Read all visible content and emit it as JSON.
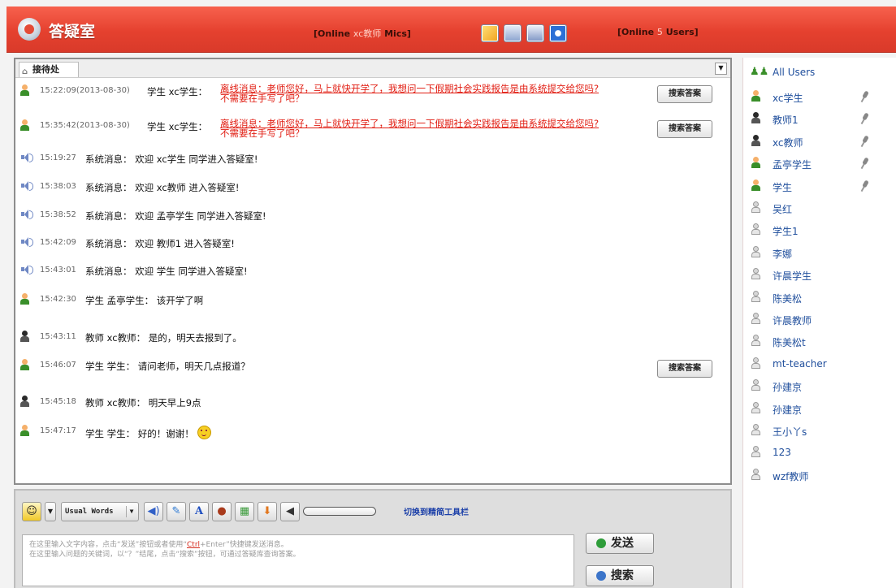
{
  "header": {
    "title": "答疑室",
    "online_mics": {
      "prefix": "[Online",
      "name": "xc教师",
      "suffix": "Mics]"
    },
    "online_users": {
      "prefix": "[Online",
      "count": "5",
      "suffix": "Users]"
    },
    "icons": [
      "folder-icon",
      "document-icon",
      "calculator-icon",
      "chat-icon"
    ]
  },
  "chat": {
    "tab_label": "接待处",
    "messages": [
      {
        "kind": "question",
        "ts": "15:22:09(2013-08-30)",
        "role": "学生",
        "name": "xc学生：",
        "line1": "离线消息：老师您好，马上就快开学了，我想问一下假期社会实践报告是由系统提交给您吗?",
        "line2": "不需要在手写了吧？",
        "button": "搜索答案"
      },
      {
        "kind": "question",
        "ts": "15:35:42(2013-08-30)",
        "role": "学生",
        "name": "xc学生：",
        "line1": "离线消息：老师您好，马上就快开学了，我想问一下假期社会实践报告是由系统提交给您吗?",
        "line2": "不需要在手写了吧？",
        "button": "搜索答案"
      },
      {
        "kind": "system",
        "ts": "15:19:27",
        "text": "系统消息： 欢迎 xc学生 同学进入答疑室!"
      },
      {
        "kind": "system",
        "ts": "15:38:03",
        "text": "系统消息： 欢迎 xc教师 进入答疑室!"
      },
      {
        "kind": "system",
        "ts": "15:38:52",
        "text": "系统消息： 欢迎 孟亭学生 同学进入答疑室!"
      },
      {
        "kind": "system",
        "ts": "15:42:09",
        "text": "系统消息： 欢迎 教师1 进入答疑室!"
      },
      {
        "kind": "system",
        "ts": "15:43:01",
        "text": "系统消息： 欢迎 学生 同学进入答疑室!"
      },
      {
        "kind": "student",
        "ts": "15:42:30",
        "text": "学生 孟亭学生： 该开学了啊"
      },
      {
        "kind": "teacher",
        "ts": "15:43:11",
        "text": "教师 xc教师： 是的，明天去报到了。"
      },
      {
        "kind": "student",
        "ts": "15:46:07",
        "text": "学生 学生： 请问老师，明天几点报道？",
        "button": "搜索答案"
      },
      {
        "kind": "teacher",
        "ts": "15:45:18",
        "text": "教师 xc教师： 明天早上9点"
      },
      {
        "kind": "student",
        "ts": "15:47:17",
        "text": "学生 学生： 好的！谢谢！"
      }
    ]
  },
  "toolbar": {
    "usual_words": "Usual Words",
    "switch_link": "切换到精简工具栏",
    "tool_icons": [
      "emoji-icon",
      "dropdown-icon",
      "sound-icon",
      "edit-icon",
      "font-icon",
      "user-icon",
      "image-icon",
      "download-icon",
      "volume-icon"
    ]
  },
  "input": {
    "hint_line1_a": "在这里输入文字内容，点击“发送”按钮或者使用“",
    "hint_ctrl": "Ctrl",
    "hint_line1_b": "+Enter”快捷键发送消息。",
    "hint_line2": "在这里输入问题的关键词，以“？”结尾，点击“搜索”按钮，可通过答疑库查询答案。",
    "send_label": "发送",
    "search_label": "搜索"
  },
  "users": {
    "header": "All Users",
    "list": [
      {
        "name": "xc学生",
        "type": "student",
        "mic": true
      },
      {
        "name": "教师1",
        "type": "teacher",
        "mic": true
      },
      {
        "name": "xc教师",
        "type": "teacher",
        "mic": true
      },
      {
        "name": "孟亭学生",
        "type": "student",
        "mic": true
      },
      {
        "name": "学生",
        "type": "student",
        "mic": true
      },
      {
        "name": "吴红",
        "type": "offline",
        "mic": false
      },
      {
        "name": "学生1",
        "type": "offline",
        "mic": false
      },
      {
        "name": "李娜",
        "type": "offline",
        "mic": false
      },
      {
        "name": "许晨学生",
        "type": "offline",
        "mic": false
      },
      {
        "name": "陈美松",
        "type": "offline",
        "mic": false
      },
      {
        "name": "许晨教师",
        "type": "offline",
        "mic": false
      },
      {
        "name": "陈美松t",
        "type": "offline",
        "mic": false
      },
      {
        "name": "mt-teacher",
        "type": "offline",
        "mic": false
      },
      {
        "name": "孙建京",
        "type": "offline",
        "mic": false
      },
      {
        "name": "孙建京",
        "type": "offline",
        "mic": false
      },
      {
        "name": "王小丫s",
        "type": "offline",
        "mic": false
      },
      {
        "name": "123",
        "type": "offline",
        "mic": false
      },
      {
        "name": "wzf教师",
        "type": "offline",
        "mic": false
      }
    ]
  },
  "colors": {
    "header_red": "#e5412f",
    "message_red": "#e11d12",
    "user_blue": "#1f4e9c"
  }
}
